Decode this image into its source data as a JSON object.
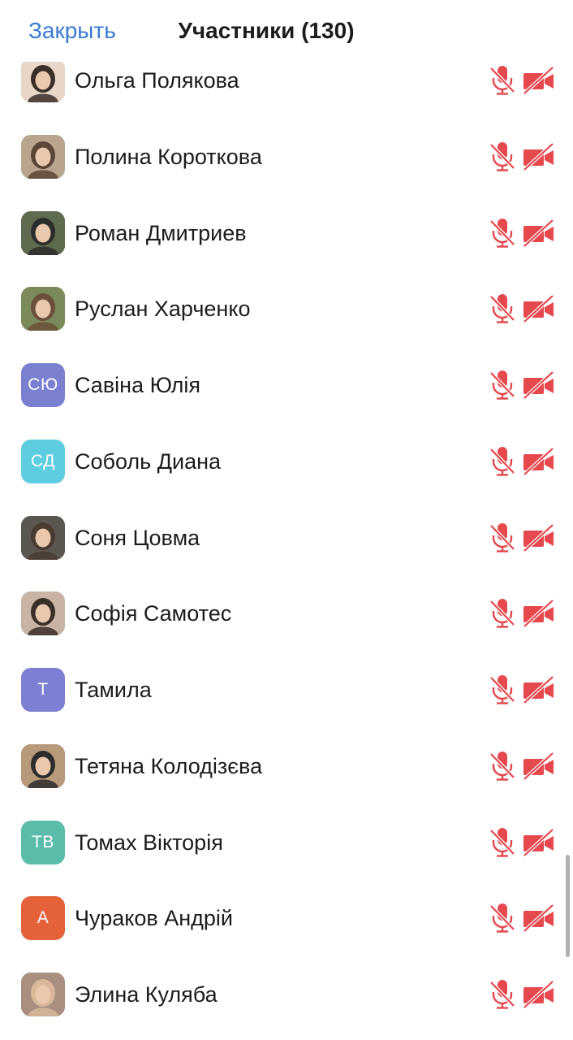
{
  "header": {
    "close_label": "Закрыть",
    "title": "Участники (130)"
  },
  "colors": {
    "accent": "#3a7bd5",
    "muted_icon": "#e5484d"
  },
  "participants": [
    {
      "name": "Ольга Полякова",
      "avatar_type": "photo",
      "initials": "",
      "avatar_color": "#e8d6c8",
      "mic": "muted-mic-icon",
      "video": "video-off-icon"
    },
    {
      "name": "Полина Короткова",
      "avatar_type": "photo",
      "initials": "",
      "avatar_color": "#b9a48e",
      "mic": "muted-mic-icon",
      "video": "video-off-icon"
    },
    {
      "name": "Роман Дмитриев",
      "avatar_type": "photo",
      "initials": "",
      "avatar_color": "#5e6b4e",
      "mic": "muted-mic-icon",
      "video": "video-off-icon"
    },
    {
      "name": "Руслан Харченко",
      "avatar_type": "photo",
      "initials": "",
      "avatar_color": "#7a8a5a",
      "mic": "muted-mic-icon",
      "video": "video-off-icon"
    },
    {
      "name": "Савіна Юлія",
      "avatar_type": "initials",
      "initials": "СЮ",
      "avatar_color": "#7a7fd0",
      "mic": "muted-mic-icon",
      "video": "video-off-icon"
    },
    {
      "name": "Соболь Диана",
      "avatar_type": "initials",
      "initials": "СД",
      "avatar_color": "#5ecde0",
      "mic": "muted-mic-icon",
      "video": "video-off-icon"
    },
    {
      "name": "Соня Цовма",
      "avatar_type": "photo",
      "initials": "",
      "avatar_color": "#5a5750",
      "mic": "muted-mic-icon",
      "video": "video-off-icon"
    },
    {
      "name": "Софія Самотес",
      "avatar_type": "photo",
      "initials": "",
      "avatar_color": "#c8b3a4",
      "mic": "muted-mic-icon",
      "video": "video-off-icon"
    },
    {
      "name": "Тамила",
      "avatar_type": "initials",
      "initials": "Т",
      "avatar_color": "#7d80d2",
      "mic": "muted-mic-icon",
      "video": "video-off-icon"
    },
    {
      "name": "Тетяна Колодізєва",
      "avatar_type": "photo",
      "initials": "",
      "avatar_color": "#b89a7a",
      "mic": "muted-mic-icon",
      "video": "video-off-icon"
    },
    {
      "name": "Томах Вікторія",
      "avatar_type": "initials",
      "initials": "ТВ",
      "avatar_color": "#5bbcaa",
      "mic": "muted-mic-icon",
      "video": "video-off-icon"
    },
    {
      "name": "Чураков Андрій",
      "avatar_type": "initials",
      "initials": "А",
      "avatar_color": "#e5613a",
      "mic": "muted-mic-icon",
      "video": "video-off-icon"
    },
    {
      "name": "Элина Куляба",
      "avatar_type": "photo",
      "initials": "",
      "avatar_color": "#a88f80",
      "mic": "muted-mic-icon",
      "video": "video-off-icon"
    }
  ]
}
